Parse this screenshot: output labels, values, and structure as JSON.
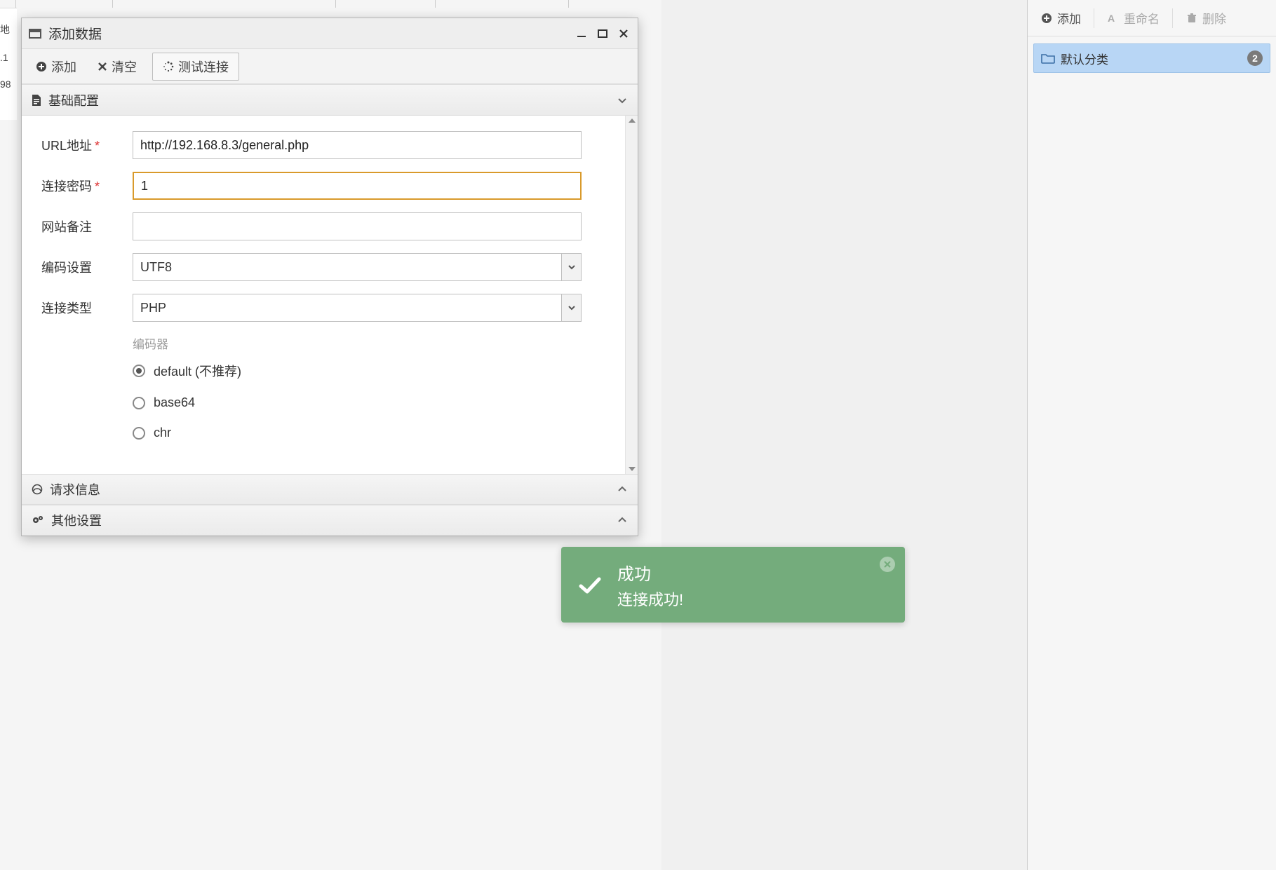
{
  "background": {
    "row_fragments": [
      "地",
      ".1",
      "98"
    ]
  },
  "sidebar": {
    "toolbar": {
      "add": "添加",
      "rename": "重命名",
      "delete": "删除"
    },
    "category": {
      "label": "默认分类",
      "count": "2"
    }
  },
  "dialog": {
    "title": "添加数据",
    "toolbar": {
      "add": "添加",
      "clear": "清空",
      "test": "测试连接"
    },
    "sections": {
      "basic": "基础配置",
      "request": "请求信息",
      "other": "其他设置"
    },
    "form": {
      "url_label": "URL地址",
      "url_value": "http://192.168.8.3/general.php",
      "password_label": "连接密码",
      "password_value": "1",
      "note_label": "网站备注",
      "note_value": "",
      "encoding_label": "编码设置",
      "encoding_value": "UTF8",
      "type_label": "连接类型",
      "type_value": "PHP",
      "encoder_label": "编码器",
      "encoders": {
        "default": "default (不推荐)",
        "base64": "base64",
        "chr": "chr"
      },
      "selected_encoder": "default"
    }
  },
  "toast": {
    "title": "成功",
    "body": "连接成功!"
  }
}
